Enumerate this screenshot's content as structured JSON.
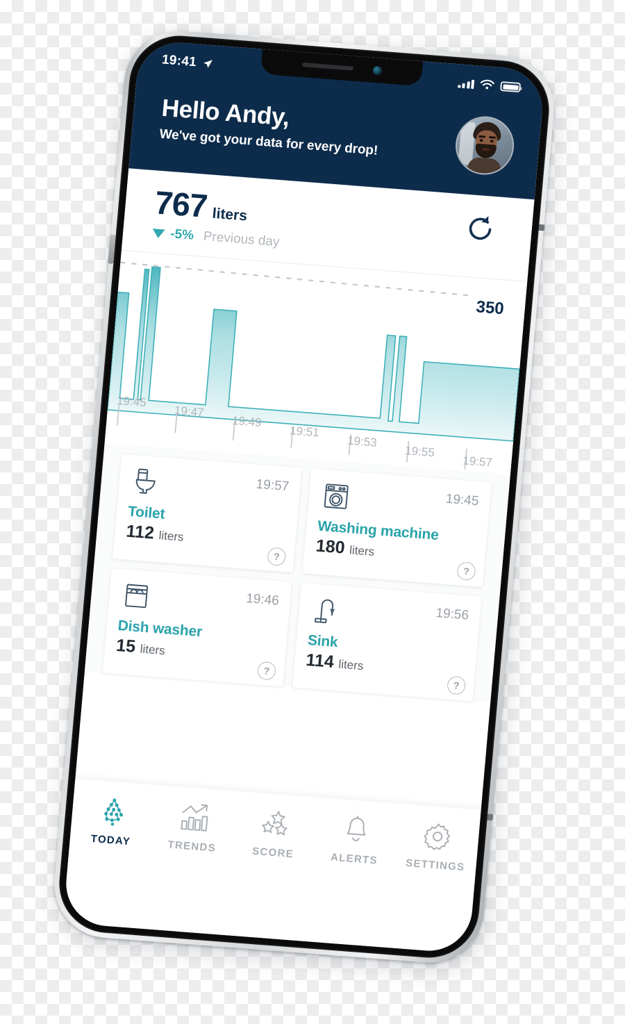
{
  "status_bar": {
    "time": "19:41",
    "location_icon": "location-arrow-icon",
    "signal_icon": "cellular-signal-icon",
    "wifi_icon": "wifi-icon",
    "battery_icon": "battery-full-icon"
  },
  "header": {
    "greeting": "Hello Andy,",
    "subtitle": "We've got your data for every drop!",
    "avatar_name": "user-avatar",
    "bg_color": "#0d2c4b"
  },
  "summary": {
    "total": "767",
    "unit": "liters",
    "delta_direction": "down",
    "delta": "-5%",
    "comparison": "Previous day",
    "refresh_icon": "refresh-icon",
    "accent_color": "#33a8b0"
  },
  "chart_data": {
    "type": "area",
    "title": "",
    "xlabel": "",
    "ylabel": "",
    "goal_label": "350",
    "goal_value": 350,
    "ylim": [
      0,
      400
    ],
    "grid": false,
    "legend": "none",
    "tick_labels": [
      "19:45",
      "19:47",
      "19:49",
      "19:51",
      "19:53",
      "19:55",
      "19:57"
    ],
    "x": [
      "19:44.2",
      "19:44.6",
      "19:45.1",
      "19:45.6",
      "19:46.0",
      "19:46.3",
      "19:46.5",
      "19:46.8",
      "19:47.0",
      "19:48.6",
      "19:49.5",
      "19:54.2",
      "19:54.6",
      "19:54.8",
      "19:55.0",
      "19:55.2",
      "19:56.0",
      "19:58.0"
    ],
    "values": [
      60,
      305,
      60,
      350,
      60,
      355,
      60,
      352,
      60,
      60,
      290,
      60,
      280,
      60,
      280,
      60,
      225,
      225
    ],
    "series": [
      {
        "name": "Flow",
        "values": [
          60,
          305,
          60,
          350,
          60,
          355,
          60,
          352,
          60,
          60,
          290,
          60,
          280,
          60,
          280,
          60,
          225,
          225
        ]
      }
    ],
    "fill_top_color": "#45b3bb",
    "fill_bottom_color": "#eaf7f8",
    "baseline_value": 60
  },
  "cards": [
    {
      "icon": "toilet-icon",
      "time": "19:57",
      "name": "Toilet",
      "value": "112",
      "unit": "liters",
      "help": "?"
    },
    {
      "icon": "washing-machine-icon",
      "time": "19:45",
      "name": "Washing machine",
      "value": "180",
      "unit": "liters",
      "help": "?"
    },
    {
      "icon": "dishwasher-icon",
      "time": "19:46",
      "name": "Dish washer",
      "value": "15",
      "unit": "liters",
      "help": "?"
    },
    {
      "icon": "faucet-icon",
      "time": "19:56",
      "name": "Sink",
      "value": "114",
      "unit": "liters",
      "help": "?"
    }
  ],
  "tabbar": {
    "items": [
      {
        "label": "TODAY",
        "icon": "water-drop-dots-icon",
        "active": true
      },
      {
        "label": "TRENDS",
        "icon": "bar-chart-trend-icon",
        "active": false
      },
      {
        "label": "SCORE",
        "icon": "three-stars-icon",
        "active": false
      },
      {
        "label": "ALERTS",
        "icon": "bell-icon",
        "active": false
      },
      {
        "label": "SETTINGS",
        "icon": "gear-icon",
        "active": false
      }
    ]
  }
}
